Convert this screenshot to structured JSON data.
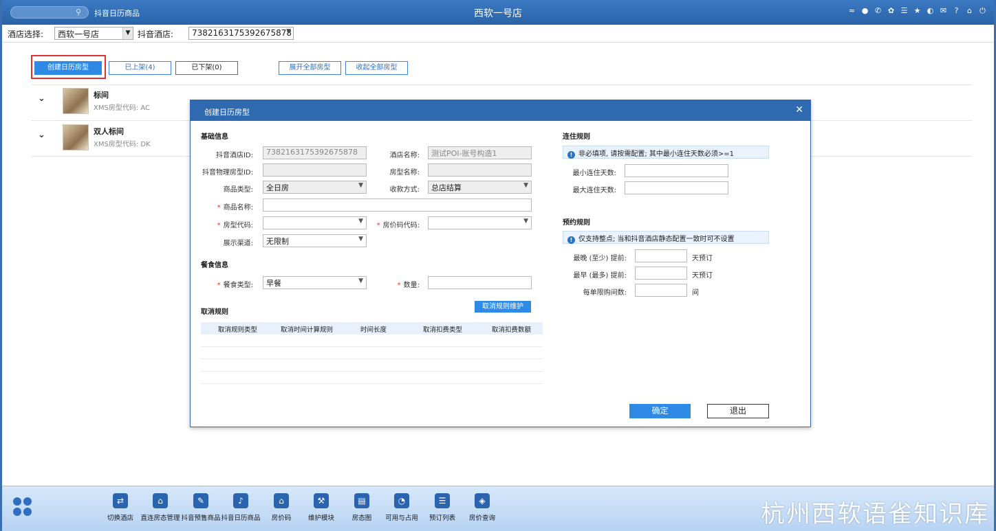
{
  "titlebar": {
    "app_name": "抖音日历商品",
    "hotel_name": "西软一号店",
    "icons": [
      "wifi-icon",
      "chat-icon",
      "phone-icon",
      "palette-icon",
      "menu-icon",
      "star-icon",
      "contrast-icon",
      "mail-icon",
      "help-icon",
      "home-icon",
      "power-icon"
    ]
  },
  "filter": {
    "hotel_select_label": "酒店选择:",
    "hotel_select_value": "西软一号店",
    "douyin_hotel_label": "抖音酒店:",
    "douyin_hotel_value": "7382163175392675878"
  },
  "toolbar": {
    "create": "创建日历房型",
    "listed": "已上架(4)",
    "delisted": "已下架(0)",
    "expand_all": "展开全部房型",
    "collapse_all": "收起全部房型"
  },
  "rooms": [
    {
      "name": "标间",
      "code": "XMS房型代码: AC"
    },
    {
      "name": "双人标间",
      "code": "XMS房型代码: DK"
    }
  ],
  "modal": {
    "title": "创建日历房型",
    "basic": {
      "section": "基础信息",
      "douyin_hotel_id_label": "抖音酒店ID:",
      "douyin_hotel_id_value": "7382163175392675878",
      "hotel_name_label": "酒店名称:",
      "hotel_name_value": "测试POI-账号构造1",
      "physical_room_id_label": "抖音物理房型ID:",
      "physical_room_id_value": "",
      "room_name_label": "房型名称:",
      "room_name_value": "",
      "product_type_label": "商品类型:",
      "product_type_value": "全日房",
      "payment_label": "收款方式:",
      "payment_value": "总店结算",
      "product_name_label": "商品名称:",
      "room_code_label": "房型代码:",
      "rate_code_label": "房价码代码:",
      "channel_label": "展示渠道:",
      "channel_value": "无限制"
    },
    "meal": {
      "section": "餐食信息",
      "type_label": "餐食类型:",
      "type_value": "早餐",
      "qty_label": "数量:"
    },
    "cancel": {
      "section": "取消规则",
      "maintain_button": "取消规则维护",
      "columns": [
        "取消规则类型",
        "取消时间计算规则",
        "时间长度",
        "取消扣费类型",
        "取消扣费数额"
      ]
    },
    "stay": {
      "section": "连住规则",
      "notice": "非必填项, 请按需配置; 其中最小连住天数必须>=1",
      "min_label": "最小连住天数:",
      "max_label": "最大连住天数:"
    },
    "booking": {
      "section": "预约规则",
      "notice": "仅支持整点; 当和抖音酒店静态配置一致时可不设置",
      "latest_label": "最晚 (至少) 提前:",
      "earliest_label": "最早 (最多) 提前:",
      "limit_label": "每单限购间数:",
      "day_unit": "天预订",
      "room_unit": "间"
    },
    "confirm": "确定",
    "exit": "退出"
  },
  "bottom_nav": [
    {
      "label": "切换酒店",
      "icon": "switch-icon"
    },
    {
      "label": "直连房态管理",
      "icon": "house-settings-icon"
    },
    {
      "label": "抖音预售商品",
      "icon": "presale-icon"
    },
    {
      "label": "抖音日历商品",
      "icon": "tiktok-icon"
    },
    {
      "label": "房价码",
      "icon": "house-icon"
    },
    {
      "label": "维护模块",
      "icon": "wrench-icon"
    },
    {
      "label": "房态图",
      "icon": "building-icon"
    },
    {
      "label": "可用与占用",
      "icon": "pie-icon"
    },
    {
      "label": "预订列表",
      "icon": "list-icon"
    },
    {
      "label": "房价查询",
      "icon": "price-query-icon"
    }
  ],
  "watermark": "杭州西软语雀知识库"
}
